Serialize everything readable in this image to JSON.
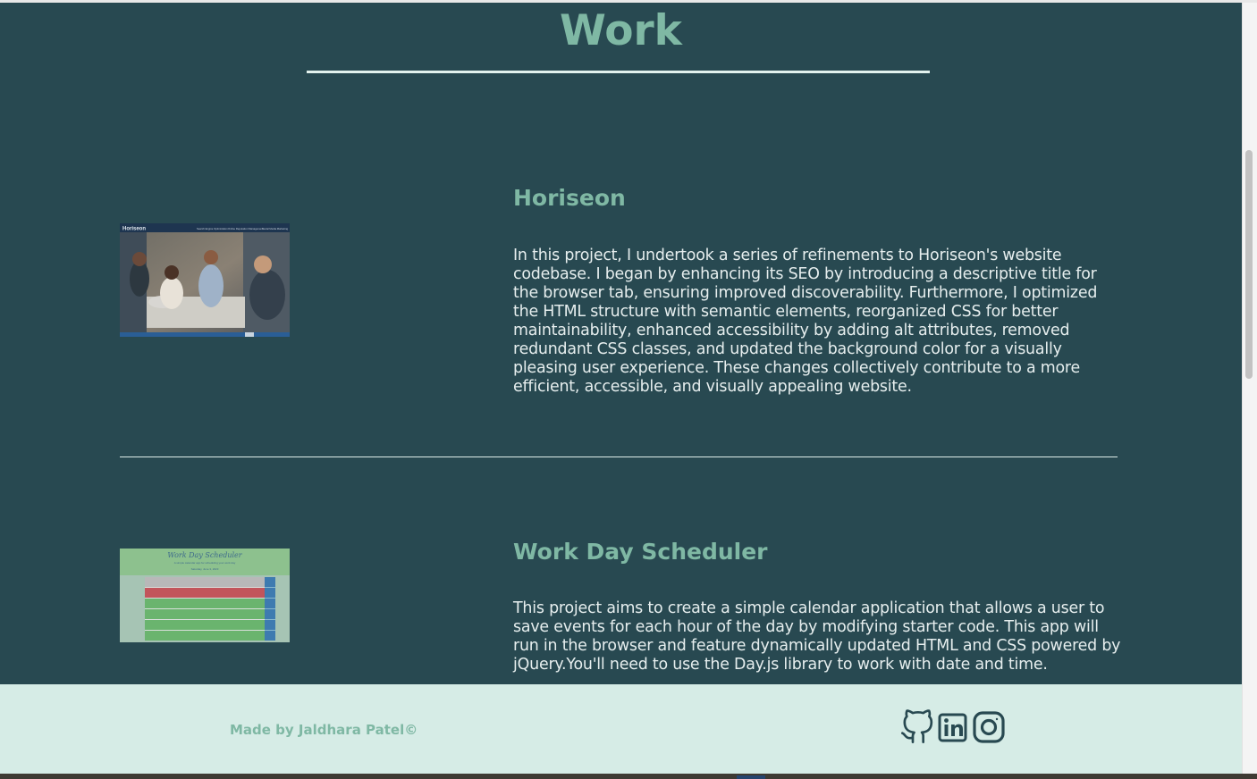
{
  "section": {
    "title": "Work"
  },
  "projects": [
    {
      "title": "Horiseon",
      "description": "In this project, I undertook a series of refinements to Horiseon's website codebase. I began by enhancing its SEO by introducing a descriptive title for the browser tab, ensuring improved discoverability. Furthermore, I optimized the HTML structure with semantic elements, reorganized CSS for better maintainability, enhanced accessibility by adding alt attributes, removed redundant CSS classes, and updated the background color for a visually pleasing user experience. These changes collectively contribute to a more efficient, accessible, and visually appealing website.",
      "thumbnail": {
        "brand": "Horiseon",
        "nav": [
          "Search Engine Optimization",
          "Online Reputation Management",
          "Social Media Marketing"
        ]
      }
    },
    {
      "title": "Work Day Scheduler",
      "description": "This project aims to create a simple calendar application that allows a user to save events for each hour of the day by modifying starter code. This app will run in the browser and feature dynamically updated HTML and CSS powered by jQuery.You'll need to use the Day.js library to work with date and time.",
      "thumbnail": {
        "title": "Work Day Scheduler",
        "subtitle": "A simple calendar app for scheduling your work day",
        "date": "Saturday, June 3, 2023"
      }
    }
  ],
  "footer": {
    "credit": "Made by Jaldhara Patel©",
    "social": [
      {
        "icon": "github-icon"
      },
      {
        "icon": "linkedin-icon"
      },
      {
        "icon": "instagram-icon"
      }
    ]
  },
  "colors": {
    "page_background": "#284951",
    "accent": "#7fb8a4",
    "footer_background": "#d6ece6",
    "body_text": "#e6eeee",
    "icon": "#284951"
  }
}
